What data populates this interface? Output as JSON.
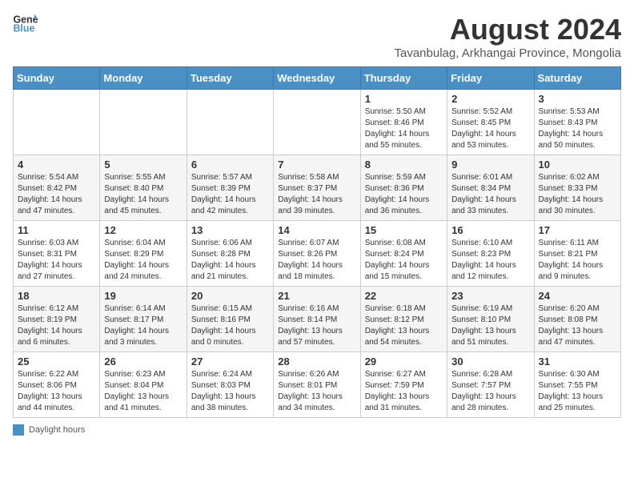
{
  "header": {
    "logo_line1": "General",
    "logo_line2": "Blue",
    "month_year": "August 2024",
    "location": "Tavanbulag, Arkhangai Province, Mongolia"
  },
  "days_of_week": [
    "Sunday",
    "Monday",
    "Tuesday",
    "Wednesday",
    "Thursday",
    "Friday",
    "Saturday"
  ],
  "legend": {
    "label": "Daylight hours"
  },
  "weeks": [
    [
      {
        "day": "",
        "info": ""
      },
      {
        "day": "",
        "info": ""
      },
      {
        "day": "",
        "info": ""
      },
      {
        "day": "",
        "info": ""
      },
      {
        "day": "1",
        "info": "Sunrise: 5:50 AM\nSunset: 8:46 PM\nDaylight: 14 hours\nand 55 minutes."
      },
      {
        "day": "2",
        "info": "Sunrise: 5:52 AM\nSunset: 8:45 PM\nDaylight: 14 hours\nand 53 minutes."
      },
      {
        "day": "3",
        "info": "Sunrise: 5:53 AM\nSunset: 8:43 PM\nDaylight: 14 hours\nand 50 minutes."
      }
    ],
    [
      {
        "day": "4",
        "info": "Sunrise: 5:54 AM\nSunset: 8:42 PM\nDaylight: 14 hours\nand 47 minutes."
      },
      {
        "day": "5",
        "info": "Sunrise: 5:55 AM\nSunset: 8:40 PM\nDaylight: 14 hours\nand 45 minutes."
      },
      {
        "day": "6",
        "info": "Sunrise: 5:57 AM\nSunset: 8:39 PM\nDaylight: 14 hours\nand 42 minutes."
      },
      {
        "day": "7",
        "info": "Sunrise: 5:58 AM\nSunset: 8:37 PM\nDaylight: 14 hours\nand 39 minutes."
      },
      {
        "day": "8",
        "info": "Sunrise: 5:59 AM\nSunset: 8:36 PM\nDaylight: 14 hours\nand 36 minutes."
      },
      {
        "day": "9",
        "info": "Sunrise: 6:01 AM\nSunset: 8:34 PM\nDaylight: 14 hours\nand 33 minutes."
      },
      {
        "day": "10",
        "info": "Sunrise: 6:02 AM\nSunset: 8:33 PM\nDaylight: 14 hours\nand 30 minutes."
      }
    ],
    [
      {
        "day": "11",
        "info": "Sunrise: 6:03 AM\nSunset: 8:31 PM\nDaylight: 14 hours\nand 27 minutes."
      },
      {
        "day": "12",
        "info": "Sunrise: 6:04 AM\nSunset: 8:29 PM\nDaylight: 14 hours\nand 24 minutes."
      },
      {
        "day": "13",
        "info": "Sunrise: 6:06 AM\nSunset: 8:28 PM\nDaylight: 14 hours\nand 21 minutes."
      },
      {
        "day": "14",
        "info": "Sunrise: 6:07 AM\nSunset: 8:26 PM\nDaylight: 14 hours\nand 18 minutes."
      },
      {
        "day": "15",
        "info": "Sunrise: 6:08 AM\nSunset: 8:24 PM\nDaylight: 14 hours\nand 15 minutes."
      },
      {
        "day": "16",
        "info": "Sunrise: 6:10 AM\nSunset: 8:23 PM\nDaylight: 14 hours\nand 12 minutes."
      },
      {
        "day": "17",
        "info": "Sunrise: 6:11 AM\nSunset: 8:21 PM\nDaylight: 14 hours\nand 9 minutes."
      }
    ],
    [
      {
        "day": "18",
        "info": "Sunrise: 6:12 AM\nSunset: 8:19 PM\nDaylight: 14 hours\nand 6 minutes."
      },
      {
        "day": "19",
        "info": "Sunrise: 6:14 AM\nSunset: 8:17 PM\nDaylight: 14 hours\nand 3 minutes."
      },
      {
        "day": "20",
        "info": "Sunrise: 6:15 AM\nSunset: 8:16 PM\nDaylight: 14 hours\nand 0 minutes."
      },
      {
        "day": "21",
        "info": "Sunrise: 6:16 AM\nSunset: 8:14 PM\nDaylight: 13 hours\nand 57 minutes."
      },
      {
        "day": "22",
        "info": "Sunrise: 6:18 AM\nSunset: 8:12 PM\nDaylight: 13 hours\nand 54 minutes."
      },
      {
        "day": "23",
        "info": "Sunrise: 6:19 AM\nSunset: 8:10 PM\nDaylight: 13 hours\nand 51 minutes."
      },
      {
        "day": "24",
        "info": "Sunrise: 6:20 AM\nSunset: 8:08 PM\nDaylight: 13 hours\nand 47 minutes."
      }
    ],
    [
      {
        "day": "25",
        "info": "Sunrise: 6:22 AM\nSunset: 8:06 PM\nDaylight: 13 hours\nand 44 minutes."
      },
      {
        "day": "26",
        "info": "Sunrise: 6:23 AM\nSunset: 8:04 PM\nDaylight: 13 hours\nand 41 minutes."
      },
      {
        "day": "27",
        "info": "Sunrise: 6:24 AM\nSunset: 8:03 PM\nDaylight: 13 hours\nand 38 minutes."
      },
      {
        "day": "28",
        "info": "Sunrise: 6:26 AM\nSunset: 8:01 PM\nDaylight: 13 hours\nand 34 minutes."
      },
      {
        "day": "29",
        "info": "Sunrise: 6:27 AM\nSunset: 7:59 PM\nDaylight: 13 hours\nand 31 minutes."
      },
      {
        "day": "30",
        "info": "Sunrise: 6:28 AM\nSunset: 7:57 PM\nDaylight: 13 hours\nand 28 minutes."
      },
      {
        "day": "31",
        "info": "Sunrise: 6:30 AM\nSunset: 7:55 PM\nDaylight: 13 hours\nand 25 minutes."
      }
    ]
  ]
}
